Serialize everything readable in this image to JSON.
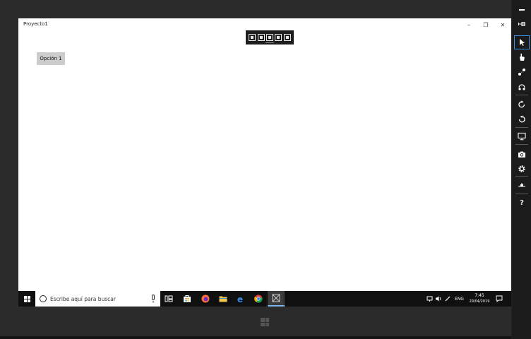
{
  "app": {
    "title": "Proyecto1",
    "option_button_label": "Opción 1"
  },
  "window_controls": {
    "minimize": "–",
    "maximize": "❐",
    "close": "✕"
  },
  "debug_toolbar": {
    "icons": [
      "select-element-icon",
      "display-layout-adorners-icon",
      "track-focus-icon",
      "hot-reload-icon",
      "in-app-selection-icon"
    ]
  },
  "simulator_toolbar": {
    "icons": [
      "minimize-icon",
      "pin-icon",
      "pointer-icon",
      "touch-icon",
      "pinch-zoom-icon",
      "rotate-touch-icon",
      "rotate-clockwise-icon",
      "rotate-counterclockwise-icon",
      "change-resolution-icon",
      "screenshot-icon",
      "settings-icon",
      "network-icon",
      "help-icon"
    ],
    "help_label": "?"
  },
  "taskbar": {
    "search_placeholder": "Escribe aquí para buscar",
    "apps": [
      "task-view-icon",
      "store-icon",
      "firefox-icon",
      "file-explorer-icon",
      "edge-icon",
      "chrome-icon",
      "app-icon"
    ],
    "tray": {
      "language": "ENG",
      "time": "7:45",
      "date": "29/04/2019"
    }
  },
  "colors": {
    "taskbar_bg": "#101010",
    "screen_bg": "#ffffff",
    "button_bg": "#cccccc",
    "active_accent": "#3a8ee6"
  }
}
